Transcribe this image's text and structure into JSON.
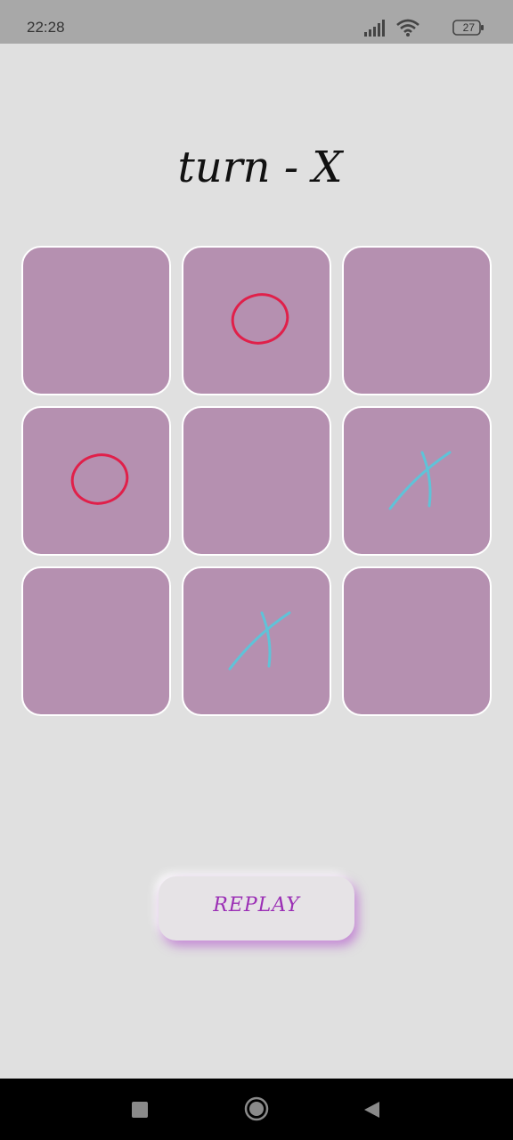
{
  "status_bar": {
    "time": "22:28",
    "battery": "27",
    "icons": [
      "signal-icon",
      "wifi-icon",
      "battery-icon"
    ]
  },
  "game": {
    "turn_label": "turn - X",
    "board": [
      "",
      "O",
      "",
      "O",
      "",
      "X",
      "",
      "X",
      ""
    ]
  },
  "replay": {
    "label": "REPLAY"
  },
  "nav": {
    "icons": [
      "recents-icon",
      "home-icon",
      "back-icon"
    ]
  },
  "colors": {
    "background": "#e0e0e0",
    "cell": "#b590b0",
    "o_mark": "#e0204a",
    "x_mark": "#5fc3d8",
    "replay_text": "#9b2fb5",
    "title": "#111111"
  }
}
